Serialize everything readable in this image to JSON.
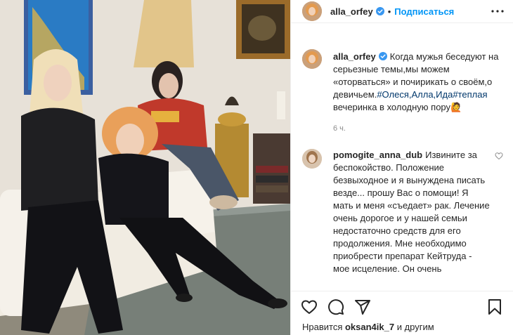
{
  "post": {
    "author": "alla_orfey",
    "follow_label": "Подписаться",
    "separator": "•",
    "caption_user": "alla_orfey",
    "caption_text_1": "Когда мужья беседуют на серьезные темы,мы можем «оторваться» и почирикать о своём,о девичьем.",
    "caption_hashtag_1": "#Олеся,Алла,Ида",
    "caption_hashtag_2": "#теплая",
    "caption_text_2": " вечеринка в холодную пору🙋",
    "time": "6 ч."
  },
  "comments": [
    {
      "user": "pomogite_anna_dub",
      "text": "Извините за беспокойство. Положение безвыходное и я вынуждена писать везде... прошу Вас о помощи! Я мать и меня «съедает» рак. Лечение очень дорогое и у нашей семьи недостаточно средств для его продолжения. Мне необходимо приобрести препарат Кейтруда - мое исцеление. Он очень"
    }
  ],
  "footer": {
    "likes_prefix": "Нравится ",
    "likes_user": "oksan4ik_7",
    "likes_suffix": " и другим"
  },
  "icons": [
    "verified-badge-icon",
    "more-options-icon",
    "heart-icon",
    "comment-icon",
    "share-icon",
    "bookmark-icon"
  ],
  "colors": {
    "accent": "#0095f6",
    "hashtag": "#00376b",
    "muted": "#8e8e8e",
    "text": "#262626",
    "border": "#efefef"
  }
}
